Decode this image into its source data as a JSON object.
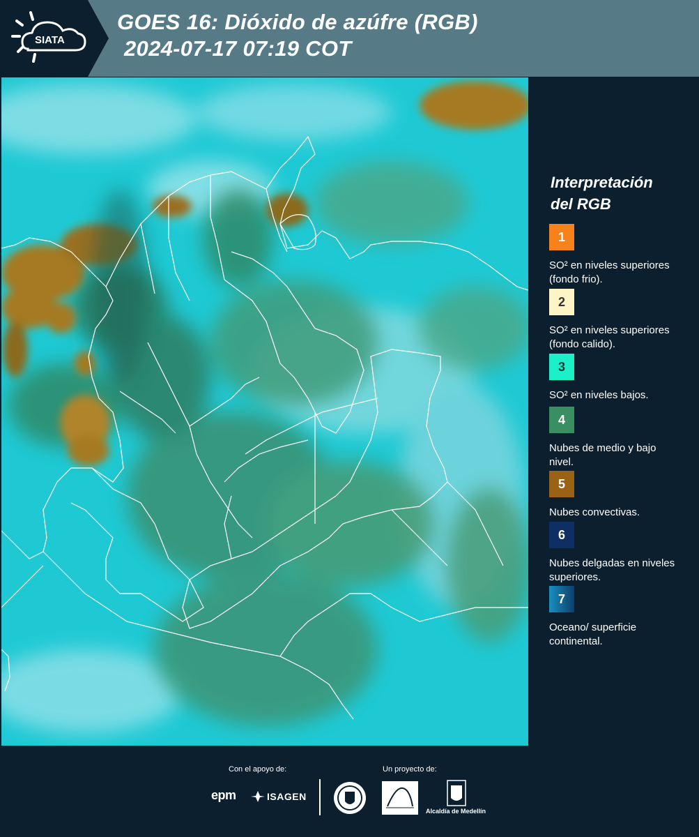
{
  "header": {
    "logo_text": "SIATA",
    "title_line1": "GOES 16: Dióxido de azúfre (RGB)",
    "title_line2": "2024-07-17 07:19 COT"
  },
  "legend": {
    "title_line1": "Interpretación",
    "title_line2": "del RGB",
    "items": [
      {
        "number": "1",
        "color": "#f7821b",
        "text": "SO² en niveles superiores (fondo frio)."
      },
      {
        "number": "2",
        "color": "#fdf5c6",
        "text": "SO² en niveles superiores (fondo calido)."
      },
      {
        "number": "3",
        "color": "#1cf0c8",
        "text": "SO² en niveles bajos."
      },
      {
        "number": "4",
        "color": "#3a8f62",
        "text": "Nubes de medio y bajo nivel."
      },
      {
        "number": "5",
        "color": "#9a6214",
        "text": "Nubes convectivas."
      },
      {
        "number": "6",
        "color": "#0e2f63",
        "text": "Nubes delgadas en niveles superiores."
      },
      {
        "number": "7",
        "color": "#1a8fc0",
        "text": "Oceano/ superficie continental."
      }
    ]
  },
  "footer": {
    "support_label": "Con el apoyo de:",
    "project_label": "Un proyecto de:",
    "sponsor1": "epm",
    "sponsor2": "ISAGEN",
    "partner_area": "Área Metropolitana Valle de Aburrá",
    "partner_alcaldia": "Alcaldía de Medellín"
  },
  "map": {
    "background_color": "#1fc6d2",
    "cloud_color": "#3a9070",
    "convective_color": "#a57a22",
    "border_color": "#ffffff"
  }
}
